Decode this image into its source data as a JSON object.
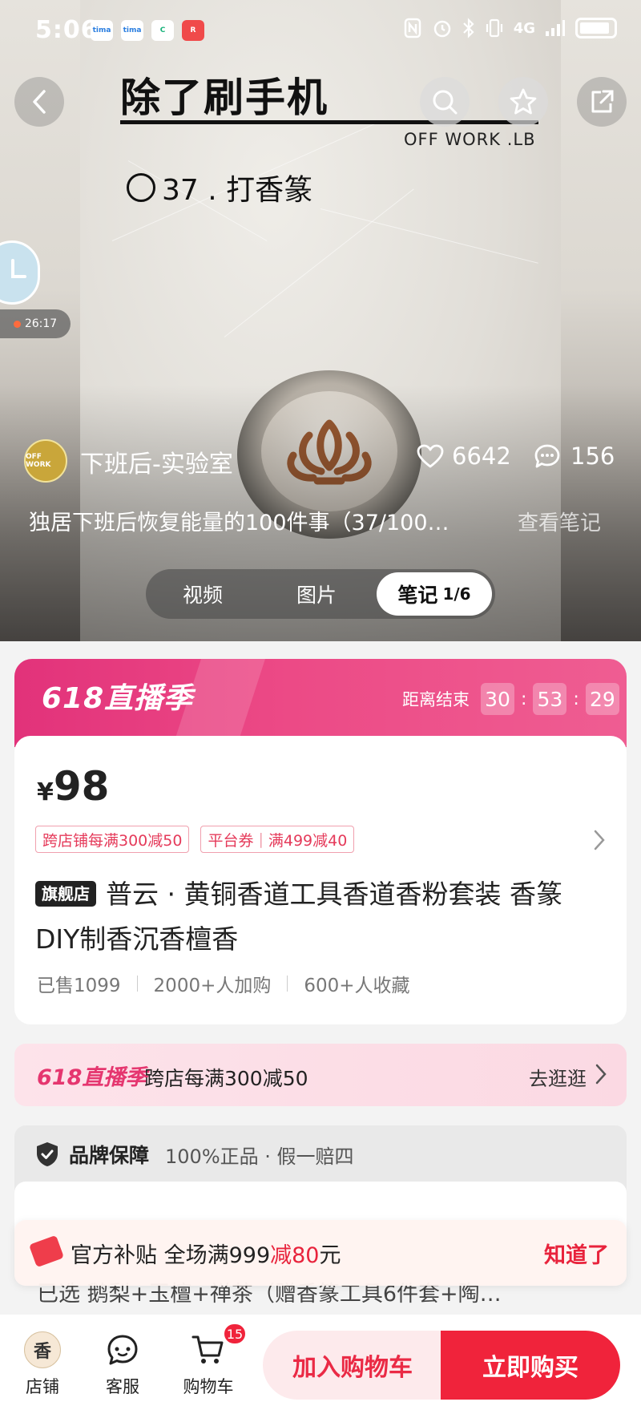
{
  "status_bar": {
    "time": "5:06",
    "apps": [
      "tima",
      "tima",
      "C",
      "R"
    ],
    "network": "4G"
  },
  "note_image": {
    "title": "除了刷手机",
    "subtitle": "OFF WORK .LB",
    "item": "37 . 打香篆"
  },
  "floating_widget": {
    "time": "26:17"
  },
  "author": {
    "avatar_text": "OFF WORK",
    "name": "下班后-实验室",
    "likes": "6642",
    "comments": "156"
  },
  "note": {
    "description": "独居下班后恢复能量的100件事（37/100…",
    "view_link": "查看笔记"
  },
  "media_tabs": {
    "video": "视频",
    "images": "图片",
    "notes": "笔记",
    "notes_page": "1/6"
  },
  "promo": {
    "logo": "618直播季",
    "countdown_label": "距离结束",
    "hours": "30",
    "minutes": "53",
    "seconds": "29"
  },
  "product": {
    "currency": "¥",
    "price": "98",
    "coupon_1": "跨店铺每满300减50",
    "coupon_2_a": "平台券",
    "coupon_2_b": "满499减40",
    "flagship": "旗舰店",
    "title": "普云 · 黄铜香道工具香道香粉套装 香篆DIY制香沉香檀香",
    "sold": "已售1099",
    "carted": "2000+人加购",
    "favorited": "600+人收藏"
  },
  "activity": {
    "logo": "618直播季",
    "text": "跨店每满300减50",
    "link": "去逛逛"
  },
  "guarantee": {
    "brand": "品牌保障",
    "detail": "100%正品 · 假一赔四",
    "selected": "已选 鹅梨+玉檀+禅茶（赠香篆工具6件套+陶…"
  },
  "toast": {
    "prefix": "官方补贴 全场满999",
    "highlight": "减80",
    "suffix": "元",
    "dismiss": "知道了"
  },
  "bottom_bar": {
    "shop_logo": "香",
    "shop": "店铺",
    "service": "客服",
    "cart": "购物车",
    "cart_count": "15",
    "add_to_cart": "加入购物车",
    "buy_now": "立即购买"
  },
  "colors": {
    "accent_red": "#f0233b",
    "promo_pink": "#e2327a"
  }
}
